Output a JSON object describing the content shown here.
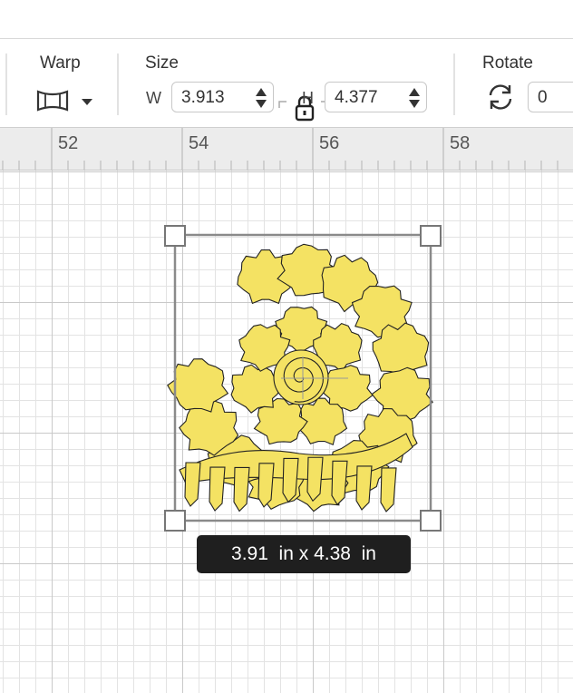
{
  "toolbar": {
    "warp": {
      "label": "Warp",
      "icon": "warp-icon"
    },
    "size": {
      "label": "Size",
      "width_letter": "W",
      "width_value": "3.913",
      "height_letter": "H",
      "height_value": "4.377",
      "lock_icon": "lock-icon"
    },
    "rotate": {
      "label": "Rotate",
      "value": "0",
      "icon": "rotate-icon"
    }
  },
  "ruler": {
    "marks": [
      "52",
      "54",
      "56",
      "58"
    ]
  },
  "canvas": {
    "selection": {
      "dimension_label": "3.91  in x 4.38  in",
      "fill_color": "#f4e263"
    }
  },
  "colors": {
    "design_fill": "#f4e263",
    "selection_stroke": "#8a8a8a",
    "tooltip_bg": "#1f1f1f"
  }
}
